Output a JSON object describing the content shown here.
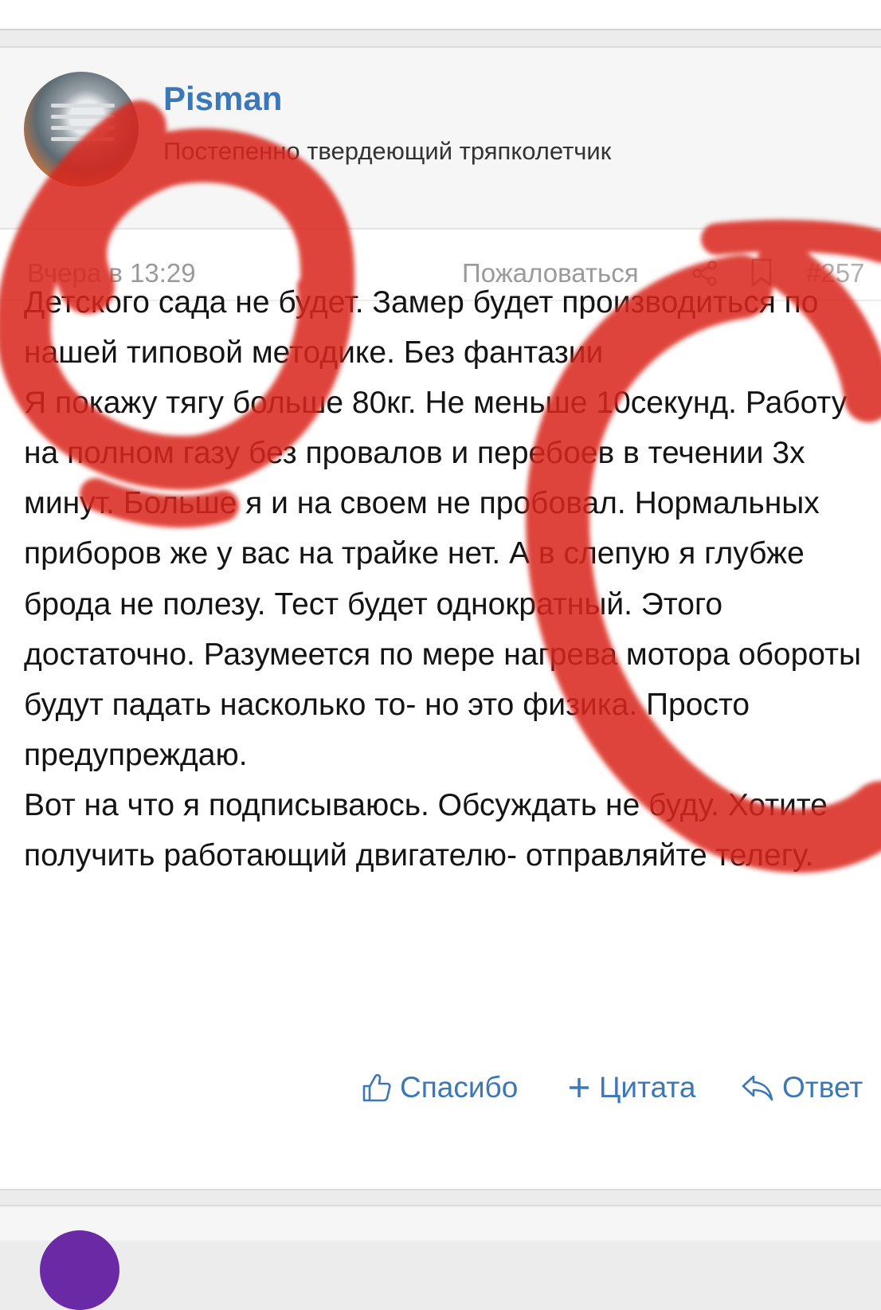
{
  "post": {
    "author": {
      "username": "Pisman",
      "title": "Постепенно твердеющий тряпколетчик"
    },
    "meta": {
      "timestamp": "Вчера в 13:29",
      "report_label": "Пожаловаться",
      "post_number": "#257"
    },
    "body": {
      "paragraph_1": "Детского сада не будет. Замер будет производиться по нашей типовой методике. Без фантазии",
      "paragraph_2": "Я покажу тягу больше 80кг. Не меньше 10секунд. Работу на полном газу без провалов и перебоев в течении 3х минут. Больше я и на своем не пробовал. Нормальных приборов же у вас на трайке нет. А в слепую я глубже брода не полезу. Тест будет однократный. Этого достаточно. Разумеется по мере нагрева мотора обороты будут падать насколько то- но это физика. Просто предупреждаю.",
      "paragraph_3": "Вот на что я подписываюсь. Обсуждать не буду. Хотите получить работающий двигателю- отправляйте телегу."
    },
    "actions": {
      "thanks_label": "Спасибо",
      "quote_label": "Цитата",
      "reply_label": "Ответ"
    }
  },
  "icons": {
    "share": "share-icon",
    "bookmark": "bookmark-icon",
    "thumbs_up": "thumbs-up-icon",
    "plus": "plus-icon",
    "reply": "reply-arrow-icon"
  },
  "colors": {
    "link": "#3b78b8",
    "muted": "#9a9a9a",
    "marker": "#d9281a",
    "background": "#ececec"
  }
}
